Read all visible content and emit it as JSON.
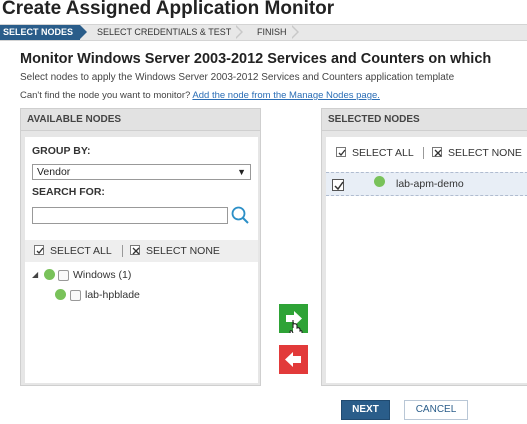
{
  "page": {
    "title": "Create Assigned Application Monitor"
  },
  "wizard": {
    "steps": [
      {
        "label": "SELECT NODES",
        "active": true
      },
      {
        "label": "SELECT CREDENTIALS & TEST",
        "active": false
      },
      {
        "label": "FINISH",
        "active": false
      }
    ]
  },
  "content": {
    "heading": "Monitor Windows Server 2003-2012 Services and Counters on which",
    "description": "Select nodes to apply the Windows Server 2003-2012 Services and Counters application template",
    "hint_text": "Can't find the node you want to monitor?",
    "hint_link": "Add the node from the Manage Nodes page."
  },
  "available": {
    "header": "AVAILABLE NODES",
    "group_by_label": "GROUP BY:",
    "group_by_value": "Vendor",
    "search_label": "SEARCH FOR:",
    "search_value": "",
    "select_all": "SELECT ALL",
    "select_none": "SELECT NONE",
    "tree": [
      {
        "label": "Windows (1)",
        "status": "up",
        "expanded": true,
        "children": [
          {
            "label": "lab-hpblade",
            "status": "up",
            "checked": false
          }
        ]
      }
    ]
  },
  "selected": {
    "header": "SELECTED NODES",
    "select_all": "SELECT ALL",
    "select_none": "SELECT NONE",
    "items": [
      {
        "label": "lab-apm-demo",
        "status": "up",
        "checked": true
      }
    ]
  },
  "actions": {
    "next": "NEXT",
    "cancel": "CANCEL"
  },
  "icons": {
    "add": "arrow-right-icon",
    "remove": "arrow-left-icon",
    "search": "search-icon",
    "status_up": "status-up-dot-icon"
  },
  "colors": {
    "accent": "#2a5d8a",
    "status_up": "#79c25a",
    "add_button": "#2ea336",
    "remove_button": "#e23a3a"
  }
}
